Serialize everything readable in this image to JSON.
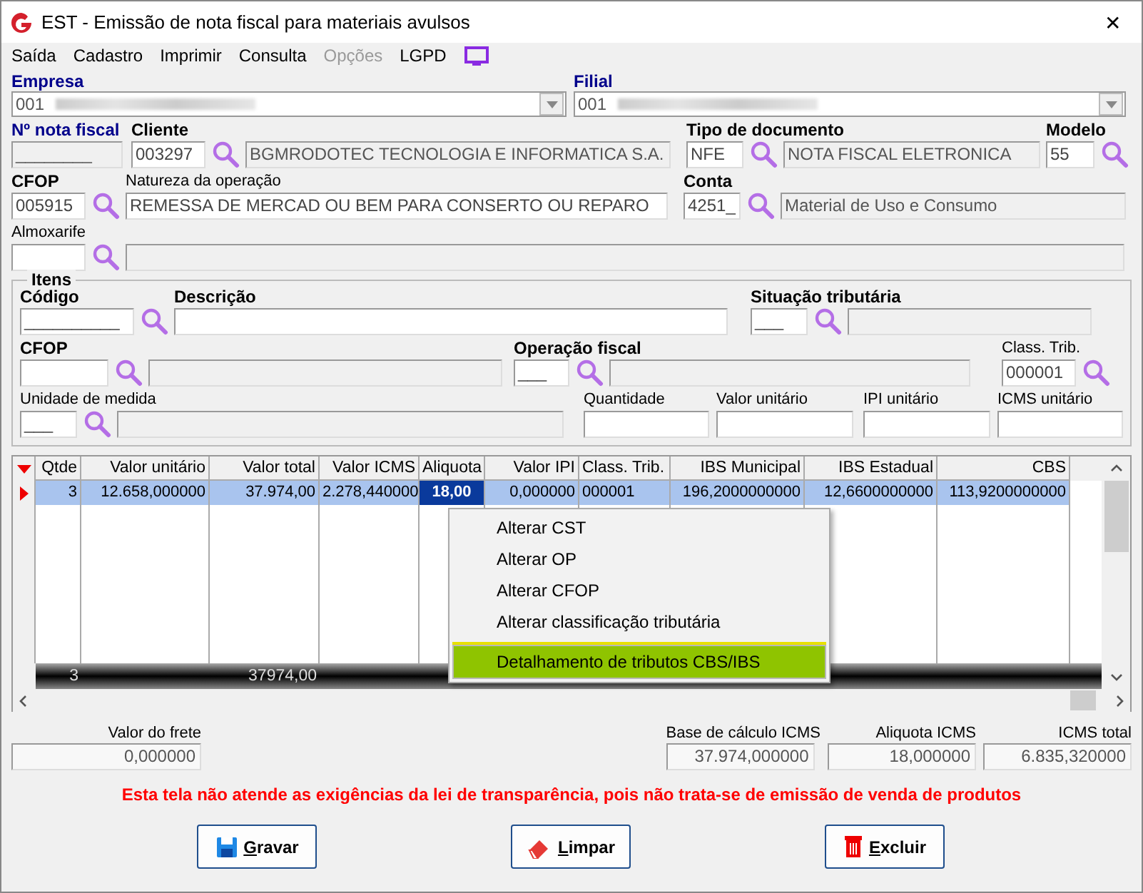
{
  "window": {
    "title": "EST - Emissão de nota fiscal para materiais avulsos",
    "close": "✕"
  },
  "menu": [
    {
      "label": "Saída",
      "disabled": false
    },
    {
      "label": "Cadastro",
      "disabled": false
    },
    {
      "label": "Imprimir",
      "disabled": false
    },
    {
      "label": "Consulta",
      "disabled": false
    },
    {
      "label": "Opções",
      "disabled": true
    },
    {
      "label": "LGPD",
      "disabled": false
    }
  ],
  "header": {
    "combos": [
      {
        "label": "Empresa",
        "value": "001"
      },
      {
        "label": "Filial",
        "value": "001"
      }
    ],
    "rows": [
      {
        "groups": [
          {
            "label": "Nº nota fiscal",
            "bold": true,
            "required": true,
            "code": {
              "value": "________",
              "disabled": true
            }
          },
          {
            "label": "Cliente",
            "bold": true,
            "required": false,
            "code": {
              "value": "003297",
              "disabled": false
            },
            "lookup": true,
            "description": {
              "value": "BGMRODOTEC TECNOLOGIA E INFORMATICA S.A.",
              "disabled": true
            }
          },
          {
            "label": "Tipo de documento",
            "bold": true,
            "required": false,
            "code": {
              "value": "NFE",
              "disabled": false
            },
            "lookup": true,
            "description": {
              "value": "NOTA FISCAL ELETRONICA",
              "disabled": true
            }
          },
          {
            "label": "Modelo",
            "bold": true,
            "required": false,
            "code": {
              "value": "55",
              "disabled": false
            },
            "lookup": true
          }
        ]
      },
      {
        "groups": [
          {
            "label": "CFOP",
            "bold": true,
            "required": false,
            "code": {
              "value": "005915",
              "disabled": false
            },
            "lookup": true
          },
          {
            "label": "Natureza da operação",
            "bold": false,
            "required": false,
            "description": {
              "value": "REMESSA DE MERCAD OU BEM PARA CONSERTO OU REPARO",
              "disabled": false
            }
          },
          {
            "label": "Conta",
            "bold": true,
            "required": false,
            "code": {
              "value": "4251_",
              "disabled": false
            },
            "lookup": true,
            "description": {
              "value": "Material de Uso e Consumo",
              "disabled": true
            }
          }
        ]
      },
      {
        "groups": [
          {
            "label": "Almoxarife",
            "bold": false,
            "required": false,
            "code": {
              "disabled": false
            },
            "lookup": true,
            "description": {
              "disabled": true
            }
          }
        ]
      }
    ]
  },
  "items": {
    "title": "Itens",
    "rows": [
      {
        "groups": [
          {
            "label": "Código",
            "bold": true,
            "required": false,
            "code": {
              "value": "__________",
              "disabled": false
            },
            "lookup": true
          },
          {
            "label": "Descrição",
            "bold": true,
            "required": false,
            "description": {
              "disabled": false
            }
          },
          {
            "label": "Situação tributária",
            "bold": true,
            "required": false,
            "code": {
              "value": "___",
              "disabled": false
            },
            "lookup": true,
            "description": {
              "disabled": true
            }
          }
        ]
      },
      {
        "groups": [
          {
            "label": "CFOP",
            "bold": true,
            "required": false,
            "code": {
              "disabled": false
            },
            "lookup": true,
            "description": {
              "disabled": true
            }
          },
          {
            "label": "Operação fiscal",
            "bold": true,
            "required": false,
            "code": {
              "value": "___",
              "disabled": false
            },
            "lookup": true,
            "description": {
              "disabled": true
            }
          },
          {
            "label": "Class. Trib.",
            "bold": false,
            "required": false,
            "code": {
              "value": "000001",
              "disabled": false
            },
            "lookup": true
          }
        ]
      },
      {
        "groups": [
          {
            "label": "Unidade de medida",
            "bold": false,
            "required": false,
            "code": {
              "value": "___",
              "disabled": false
            },
            "lookup": true,
            "description": {
              "disabled": true
            }
          },
          {
            "label": "Quantidade",
            "bold": false,
            "required": false,
            "code": {
              "disabled": false
            }
          },
          {
            "label": "Valor unitário",
            "bold": false,
            "required": false,
            "code": {
              "disabled": false
            }
          },
          {
            "label": "IPI unitário",
            "bold": false,
            "required": false,
            "code": {
              "disabled": false
            }
          },
          {
            "label": "ICMS unitário",
            "bold": false,
            "required": false,
            "code": {
              "disabled": false
            }
          }
        ]
      }
    ]
  },
  "grid": {
    "columns": [
      {
        "label": "Qtde",
        "total": "3"
      },
      {
        "label": "Valor unitário"
      },
      {
        "label": "Valor total",
        "total": "37974,00"
      },
      {
        "label": "Valor ICMS"
      },
      {
        "label": "Aliquota"
      },
      {
        "label": "Valor IPI"
      },
      {
        "label": "Class. Trib."
      },
      {
        "label": "IBS Municipal"
      },
      {
        "label": "IBS Estadual"
      },
      {
        "label": "CBS"
      }
    ],
    "rows": [
      {
        "selected": true,
        "cells": [
          {
            "text": "3",
            "focused": false
          },
          {
            "text": "12.658,000000",
            "focused": false
          },
          {
            "text": "37.974,00",
            "focused": false
          },
          {
            "text": "2.278,440000",
            "focused": false
          },
          {
            "text": "18,00",
            "focused": true
          },
          {
            "text": "0,000000",
            "focused": false
          },
          {
            "text": "000001",
            "focused": false
          },
          {
            "text": "196,2000000000",
            "focused": false
          },
          {
            "text": "12,6600000000",
            "focused": false
          },
          {
            "text": "113,9200000000",
            "focused": false
          }
        ]
      }
    ]
  },
  "context_menu": [
    {
      "kind": "item",
      "label": "Alterar CST",
      "selected": false
    },
    {
      "kind": "item",
      "label": "Alterar OP",
      "selected": false
    },
    {
      "kind": "item",
      "label": "Alterar CFOP",
      "selected": false
    },
    {
      "kind": "item",
      "label": "Alterar classificação tributária",
      "selected": false
    },
    {
      "kind": "separator"
    },
    {
      "kind": "item",
      "label": "Detalhamento de tributos CBS/IBS",
      "selected": true
    }
  ],
  "summary": {
    "freight": {
      "label": "Valor do frete",
      "value": "0,000000"
    },
    "totals": [
      {
        "label": "Base de cálculo ICMS",
        "value": "37.974,000000"
      },
      {
        "label": "Aliquota ICMS",
        "value": "18,000000"
      },
      {
        "label": "ICMS total",
        "value": "6.835,320000"
      }
    ]
  },
  "warning": "Esta tela não atende as exigências da lei de transparência, pois não trata-se de emissão de venda de produtos",
  "buttons": [
    {
      "kind": "save",
      "mnemonic": "G",
      "label": "ravar"
    },
    {
      "kind": "eraser",
      "mnemonic": "L",
      "label": "impar"
    },
    {
      "kind": "delete",
      "mnemonic": "E",
      "label": "xcluir"
    }
  ]
}
